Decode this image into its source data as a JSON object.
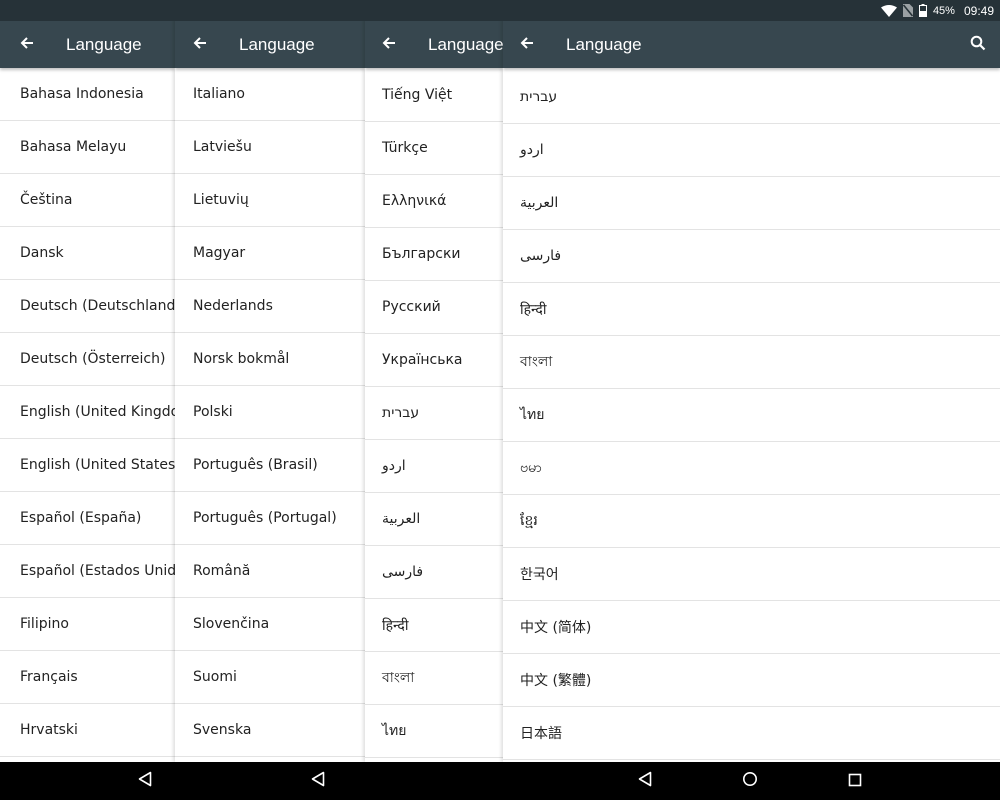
{
  "status_bar": {
    "battery_percent": "45%",
    "time": "09:49",
    "icons": [
      "wifi-icon",
      "no-sim-icon",
      "battery-icon"
    ]
  },
  "panels": [
    {
      "title": "Language",
      "items": [
        "Bahasa Indonesia",
        "Bahasa Melayu",
        "Čeština",
        "Dansk",
        "Deutsch (Deutschland)",
        "Deutsch (Österreich)",
        "English (United Kingdom)",
        "English (United States)",
        "Español (España)",
        "Español (Estados Unidos)",
        "Filipino",
        "Français",
        "Hrvatski"
      ]
    },
    {
      "title": "Language",
      "items": [
        "Italiano",
        "Latviešu",
        "Lietuvių",
        "Magyar",
        "Nederlands",
        "Norsk bokmål",
        "Polski",
        "Português (Brasil)",
        "Português (Portugal)",
        "Română",
        "Slovenčina",
        "Suomi",
        "Svenska"
      ]
    },
    {
      "title": "Language",
      "items": [
        "Tiếng Việt",
        "Türkçe",
        "Ελληνικά",
        "Български",
        "Русский",
        "Українська",
        "עברית",
        "اردو",
        "العربية",
        "فارسی",
        "हिन्दी",
        "বাংলা",
        "ไทย"
      ]
    },
    {
      "title": "Language",
      "items": [
        "עברית",
        "اردو",
        "العربية",
        "فارسی",
        "हिन्दी",
        "বাংলা",
        "ไทย",
        "ဗမာ",
        "ខ្មែរ",
        "한국어",
        "中文 (简体)",
        "中文 (繁體)",
        "日本語"
      ]
    }
  ],
  "icons": {
    "back": "arrow-back-icon",
    "search": "search-icon"
  },
  "nav_bar": {
    "buttons": [
      "back-triangle-icon",
      "home-circle-icon",
      "recents-square-icon"
    ]
  },
  "colors": {
    "status_bar": "#263238",
    "app_bar": "#37474f",
    "nav_bar": "#000000",
    "divider": "#e3e3e3"
  }
}
